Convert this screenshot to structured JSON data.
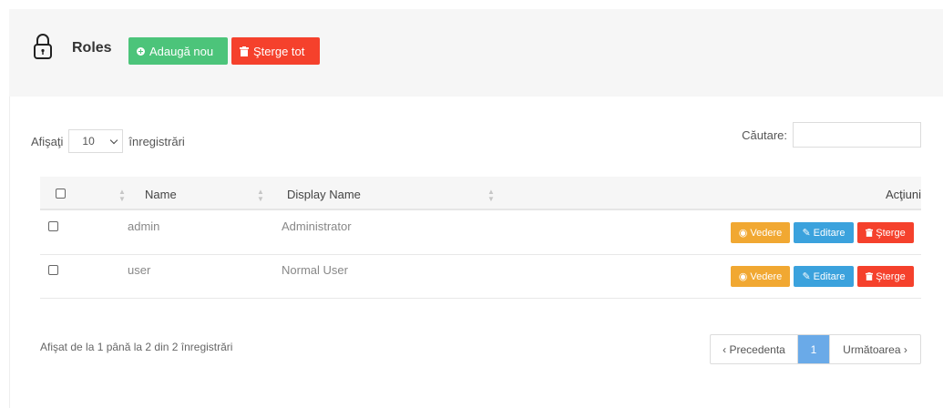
{
  "header": {
    "title": "Roles",
    "add_label": "Adaugă nou",
    "delete_all_label": "Şterge tot",
    "icon": "lock-icon"
  },
  "controls": {
    "show_label": "Afişaţi",
    "page_length": "10",
    "entries_label": "înregistrări",
    "search_label": "Căutare:",
    "search_value": ""
  },
  "table": {
    "columns": [
      "Name",
      "Display Name",
      "",
      "Acţiuni"
    ],
    "rows": [
      {
        "name": "admin",
        "display_name": "Administrator"
      },
      {
        "name": "user",
        "display_name": "Normal User"
      }
    ],
    "actions": {
      "view": "Vedere",
      "edit": "Editare",
      "delete": "Şterge"
    }
  },
  "footer": {
    "info": "Afişat de la 1 până la 2 din 2 înregistrări",
    "prev_label": "‹ Precedenta",
    "current_page": "1",
    "next_label": "Următoarea ›"
  },
  "colors": {
    "add": "#4cc47a",
    "danger": "#f5412c",
    "view": "#f1a832",
    "edit": "#3ba2dd",
    "active_page": "#6aaae8"
  }
}
